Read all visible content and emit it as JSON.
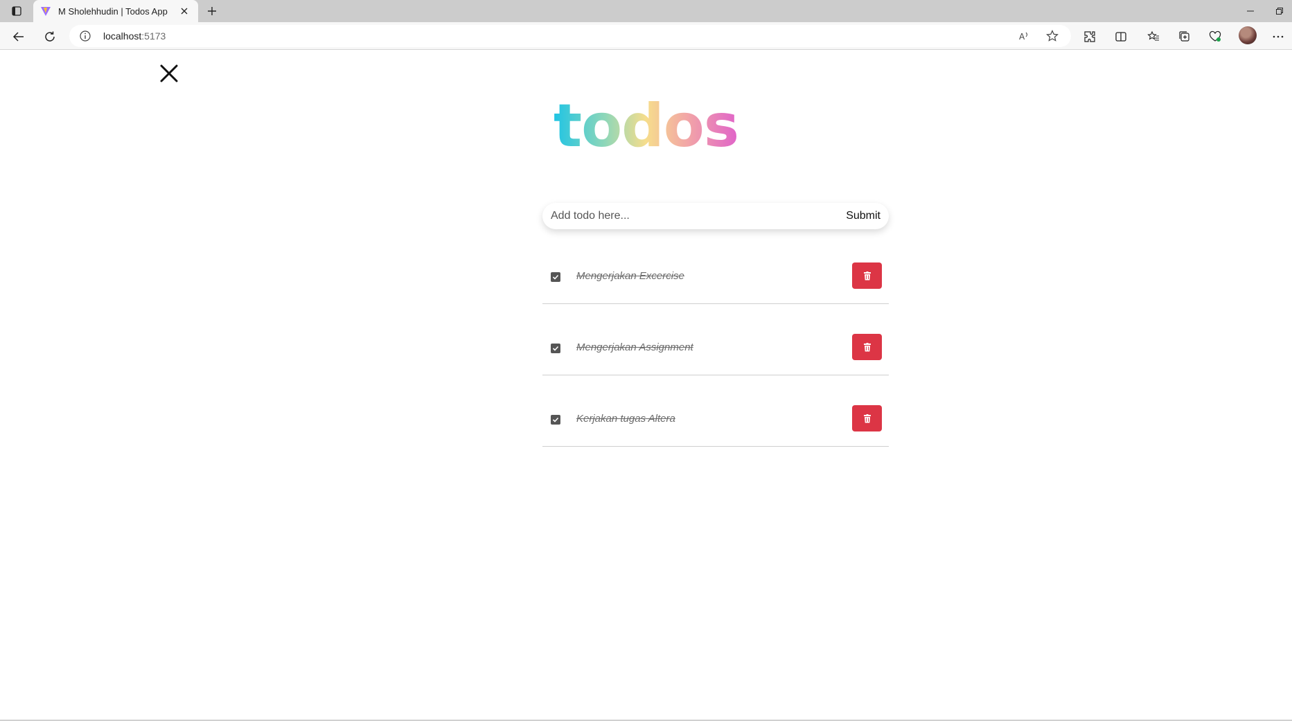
{
  "browser": {
    "tab": {
      "title": "M Sholehhudin | Todos App",
      "favicon": "vite-logo-icon"
    },
    "address": {
      "host": "localhost",
      "port": ":5173"
    },
    "icons": [
      "tab-actions-icon",
      "new-tab-icon",
      "back-icon",
      "reload-icon",
      "site-info-icon",
      "read-aloud-icon",
      "favorite-star-icon",
      "extensions-icon",
      "split-screen-icon",
      "favorites-icon",
      "collections-icon",
      "browser-essentials-icon",
      "profile-avatar",
      "more-icon"
    ]
  },
  "app": {
    "logo": "todos",
    "form": {
      "placeholder": "Add todo here...",
      "submit_label": "Submit"
    },
    "todos": [
      {
        "text": "Mengerjakan Excercise",
        "done": true
      },
      {
        "text": "Mengerjakan Assignment",
        "done": true
      },
      {
        "text": "Kerjakan tugas Altera",
        "done": true
      }
    ]
  },
  "colors": {
    "delete_button": "#dc3545",
    "logo_gradient": [
      "#1fc4e4",
      "#8fd7b8",
      "#f6dd8c",
      "#f2a6a6",
      "#e063c9"
    ]
  }
}
